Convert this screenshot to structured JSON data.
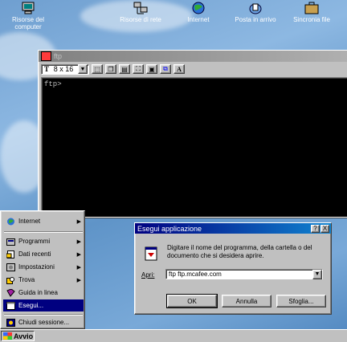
{
  "desktop": {
    "icons": [
      {
        "label": "Risorse del computer",
        "icon": "my-computer-icon"
      },
      {
        "label": "Risorse di rete",
        "icon": "network-icon"
      },
      {
        "label": "Internet",
        "icon": "internet-icon"
      },
      {
        "label": "Posta in arrivo",
        "icon": "inbox-icon"
      },
      {
        "label": "Sincronia file",
        "icon": "briefcase-icon"
      }
    ]
  },
  "ftp_window": {
    "title": "ftp",
    "font_size": "8 x 16",
    "font_toggle": "T",
    "font_button": "A",
    "console_text": "ftp>"
  },
  "run_dialog": {
    "title": "Esegui applicazione",
    "help": "?",
    "close": "X",
    "description": "Digitare il nome del programma, della cartella o del documento che si desidera aprire.",
    "open_label": "Apri:",
    "open_value": "ftp  ftp.mcafee.com",
    "buttons": {
      "ok": "OK",
      "cancel": "Annulla",
      "browse": "Sfoglia..."
    }
  },
  "start_menu": {
    "items": [
      {
        "label": "Internet",
        "icon": "internet-icon",
        "submenu": true
      },
      {
        "label": "Programmi",
        "icon": "programs-icon",
        "submenu": true
      },
      {
        "label": "Dati recenti",
        "icon": "documents-icon",
        "submenu": true
      },
      {
        "label": "Impostazioni",
        "icon": "settings-icon",
        "submenu": true
      },
      {
        "label": "Trova",
        "icon": "find-icon",
        "submenu": true
      },
      {
        "label": "Guida in linea",
        "icon": "help-icon",
        "submenu": false
      },
      {
        "label": "Esegui...",
        "icon": "run-icon",
        "submenu": false,
        "selected": true
      },
      {
        "label": "Chiudi sessione...",
        "icon": "shutdown-icon",
        "submenu": false
      }
    ]
  },
  "taskbar": {
    "start_label": "Avvio"
  },
  "colors": {
    "title_active": "#000080",
    "face": "#c0c0c0",
    "desktop": "#6f9fd0"
  }
}
